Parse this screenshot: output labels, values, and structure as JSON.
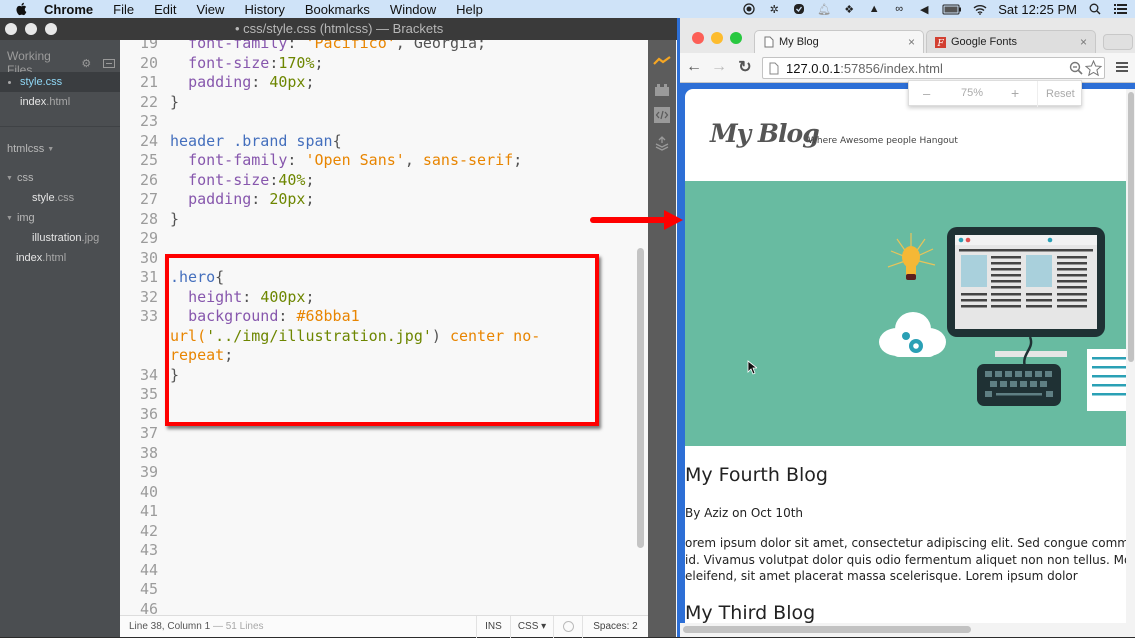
{
  "menubar": {
    "app": "Chrome",
    "items": [
      "File",
      "Edit",
      "View",
      "History",
      "Bookmarks",
      "Window",
      "Help"
    ],
    "clock": "Sat 12:25 PM",
    "tray_icons": [
      "record-icon",
      "brightness-icon",
      "skype-icon",
      "notification-bell-icon",
      "dropbox-icon",
      "google-drive-icon",
      "creative-cloud-icon",
      "volume-icon",
      "battery-icon",
      "wifi-icon",
      "spotlight-search-icon",
      "notification-center-icon"
    ]
  },
  "brackets": {
    "window_title": "• css/style.css (htmlcss) — Brackets",
    "working_files": {
      "header": "Working Files",
      "files": [
        {
          "name": "style",
          "ext": ".css",
          "active": true
        },
        {
          "name": "index",
          "ext": ".html",
          "active": false
        }
      ]
    },
    "project": {
      "name": "htmlcss",
      "tree": [
        {
          "type": "dir",
          "name": "css",
          "depth": 0
        },
        {
          "type": "file",
          "name": "style",
          "ext": ".css",
          "depth": 1
        },
        {
          "type": "dir",
          "name": "img",
          "depth": 0
        },
        {
          "type": "file",
          "name": "illustration",
          "ext": ".jpg",
          "depth": 1
        },
        {
          "type": "file",
          "name": "index",
          "ext": ".html",
          "depth": 0
        }
      ]
    },
    "code_lines": [
      {
        "n": "19",
        "tokens": [
          [
            "pun",
            "  "
          ],
          [
            "prop",
            "font-family"
          ],
          [
            "pun",
            ": "
          ],
          [
            "str",
            "'Pacifico'"
          ],
          [
            "pun",
            ", Georgia;"
          ]
        ]
      },
      {
        "n": "20",
        "tokens": [
          [
            "pun",
            "  "
          ],
          [
            "prop",
            "font-size"
          ],
          [
            "pun",
            ":"
          ],
          [
            "num",
            "170%"
          ],
          [
            "pun",
            ";"
          ]
        ]
      },
      {
        "n": "21",
        "tokens": [
          [
            "pun",
            "  "
          ],
          [
            "prop",
            "padding"
          ],
          [
            "pun",
            ": "
          ],
          [
            "num",
            "40px"
          ],
          [
            "pun",
            ";"
          ]
        ]
      },
      {
        "n": "22",
        "tokens": [
          [
            "pun",
            "}"
          ]
        ]
      },
      {
        "n": "23",
        "tokens": []
      },
      {
        "n": "24",
        "tokens": [
          [
            "sel",
            "header .brand span"
          ],
          [
            "pun",
            "{"
          ]
        ]
      },
      {
        "n": "25",
        "tokens": [
          [
            "pun",
            "  "
          ],
          [
            "prop",
            "font-family"
          ],
          [
            "pun",
            ": "
          ],
          [
            "str",
            "'Open Sans'"
          ],
          [
            "pun",
            ", "
          ],
          [
            "str",
            "sans-serif"
          ],
          [
            "pun",
            ";"
          ]
        ]
      },
      {
        "n": "26",
        "tokens": [
          [
            "pun",
            "  "
          ],
          [
            "prop",
            "font-size"
          ],
          [
            "pun",
            ":"
          ],
          [
            "num",
            "40%"
          ],
          [
            "pun",
            ";"
          ]
        ]
      },
      {
        "n": "27",
        "tokens": [
          [
            "pun",
            "  "
          ],
          [
            "prop",
            "padding"
          ],
          [
            "pun",
            ": "
          ],
          [
            "num",
            "20px"
          ],
          [
            "pun",
            ";"
          ]
        ]
      },
      {
        "n": "28",
        "tokens": [
          [
            "pun",
            "}"
          ]
        ]
      },
      {
        "n": "29",
        "tokens": []
      },
      {
        "n": "30",
        "tokens": []
      },
      {
        "n": "31",
        "tokens": [
          [
            "sel",
            ".hero"
          ],
          [
            "pun",
            "{"
          ]
        ]
      },
      {
        "n": "32",
        "tokens": [
          [
            "pun",
            "  "
          ],
          [
            "prop",
            "height"
          ],
          [
            "pun",
            ": "
          ],
          [
            "num",
            "400px"
          ],
          [
            "pun",
            ";"
          ]
        ]
      },
      {
        "n": "33",
        "tokens": [
          [
            "pun",
            "  "
          ],
          [
            "prop",
            "background"
          ],
          [
            "pun",
            ": "
          ],
          [
            "str",
            "#68bba1"
          ]
        ]
      },
      {
        "n": "",
        "tokens": [
          [
            "str",
            "url("
          ],
          [
            "num",
            "'../img/illustration.jpg'"
          ],
          [
            "pun",
            ") "
          ],
          [
            "str",
            "center no-"
          ]
        ]
      },
      {
        "n": "",
        "tokens": [
          [
            "str",
            "repeat"
          ],
          [
            "pun",
            ";"
          ]
        ]
      },
      {
        "n": "34",
        "tokens": [
          [
            "pun",
            "}"
          ]
        ]
      },
      {
        "n": "35",
        "tokens": []
      },
      {
        "n": "36",
        "tokens": []
      },
      {
        "n": "37",
        "tokens": []
      },
      {
        "n": "38",
        "tokens": []
      },
      {
        "n": "39",
        "tokens": []
      },
      {
        "n": "40",
        "tokens": []
      },
      {
        "n": "41",
        "tokens": []
      },
      {
        "n": "42",
        "tokens": []
      },
      {
        "n": "43",
        "tokens": []
      },
      {
        "n": "44",
        "tokens": []
      },
      {
        "n": "45",
        "tokens": []
      },
      {
        "n": "46",
        "tokens": []
      }
    ],
    "status": {
      "position": "Line 38, Column 1",
      "lines": " — 51 Lines",
      "mode": "INS",
      "language": "CSS ▾",
      "spaces": "Spaces: 2"
    }
  },
  "chrome": {
    "tabs": [
      {
        "title": "My Blog",
        "active": true
      },
      {
        "title": "Google Fonts",
        "active": false
      }
    ],
    "url_host": "127.0.0.1",
    "url_path": ":57856/index.html",
    "zoom_popup": {
      "minus": "–",
      "value": "75%",
      "plus": "+",
      "reset": "Reset"
    },
    "page": {
      "brand": "My Blog",
      "tagline": "Where Awesome people Hangout",
      "hero_color": "#68bba1",
      "posts": [
        {
          "title": "My Fourth Blog",
          "meta": "By Aziz on Oct 10th",
          "body_lines": [
            "orem ipsum dolor sit amet, consectetur adipiscing elit. Sed congue commodo",
            "id. Vivamus volutpat dolor quis odio fermentum aliquet non non tellus. Morbi",
            "eleifend, sit amet placerat massa scelerisque. Lorem ipsum dolor"
          ]
        },
        {
          "title": "My Third Blog"
        }
      ]
    }
  },
  "colors": {
    "annotation_red": "#ff0000",
    "brackets_sidebar": "#4b4e51",
    "chrome_frame_blue": "#2d6fd6"
  }
}
